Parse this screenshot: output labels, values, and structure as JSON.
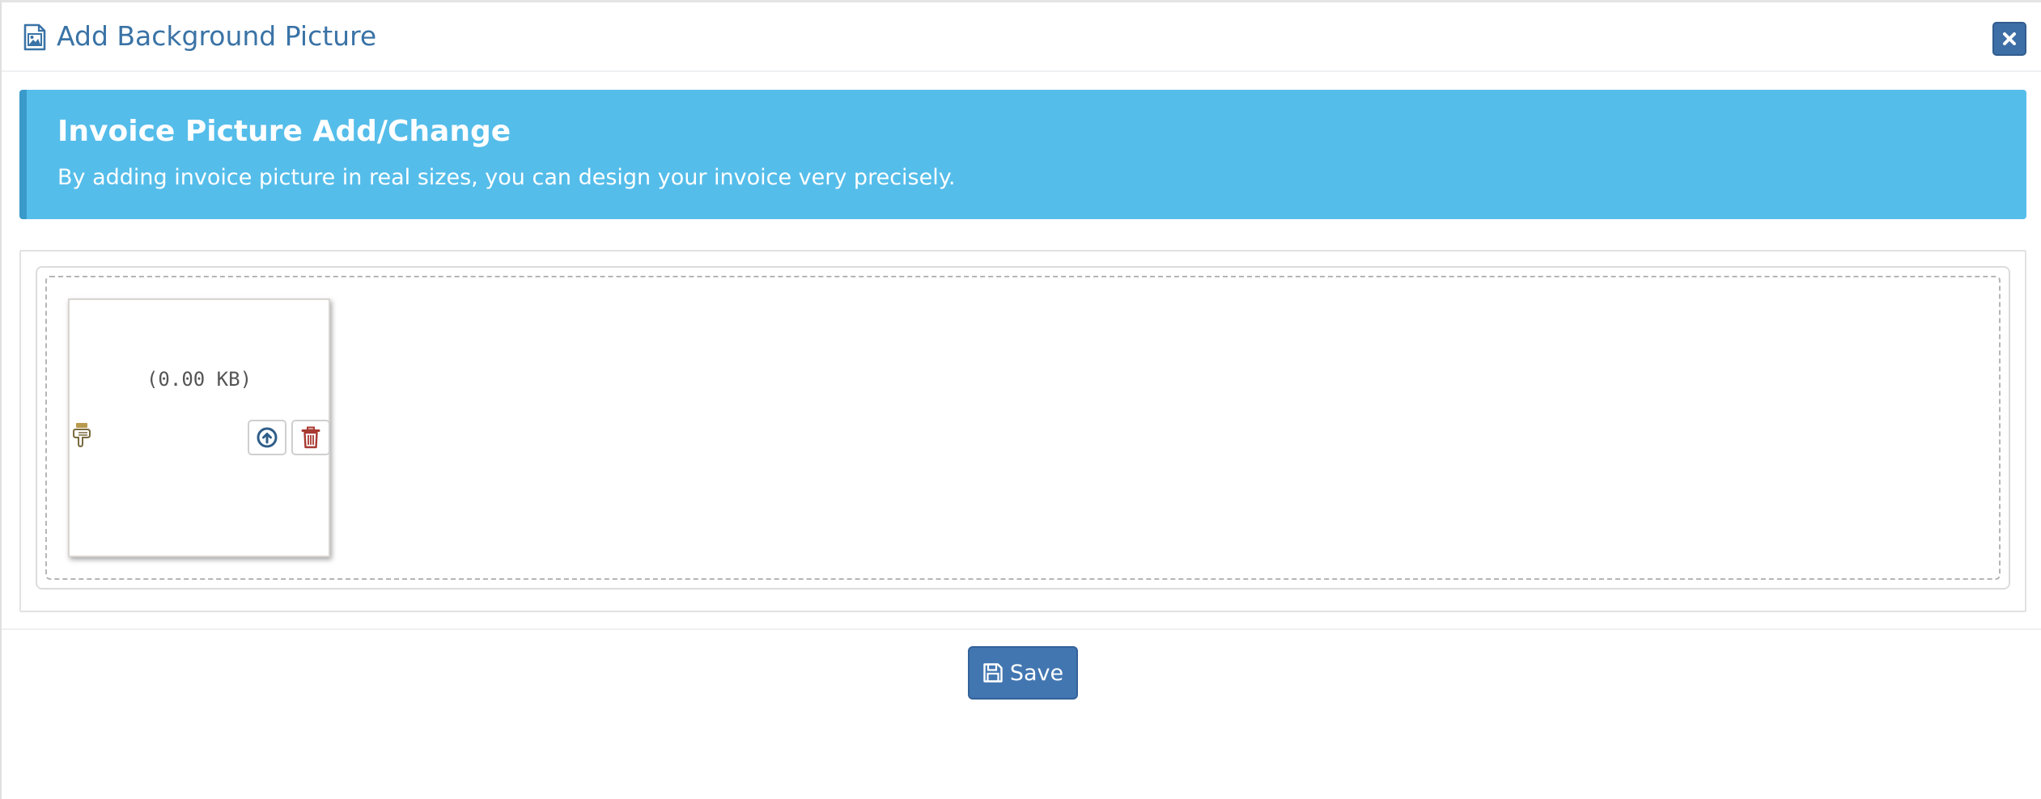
{
  "header": {
    "title": "Add Background Picture",
    "title_icon": "image-file-icon",
    "close_icon": "close-icon"
  },
  "callout": {
    "title": "Invoice Picture Add/Change",
    "text": "By adding invoice picture in real sizes, you can design your invoice very precisely."
  },
  "upload": {
    "file_size": "(0.00 KB)",
    "drag_icon": "hand-point-down-icon",
    "upload_icon": "arrow-circle-up-icon",
    "delete_icon": "trash-icon"
  },
  "footer": {
    "save_label": "Save",
    "save_icon": "floppy-disk-icon"
  },
  "colors": {
    "primary": "#4276b1",
    "title_blue": "#3a73a6",
    "callout_bg": "#55bdea",
    "callout_border": "#3a9ac9",
    "delete_red": "#a83a32"
  }
}
